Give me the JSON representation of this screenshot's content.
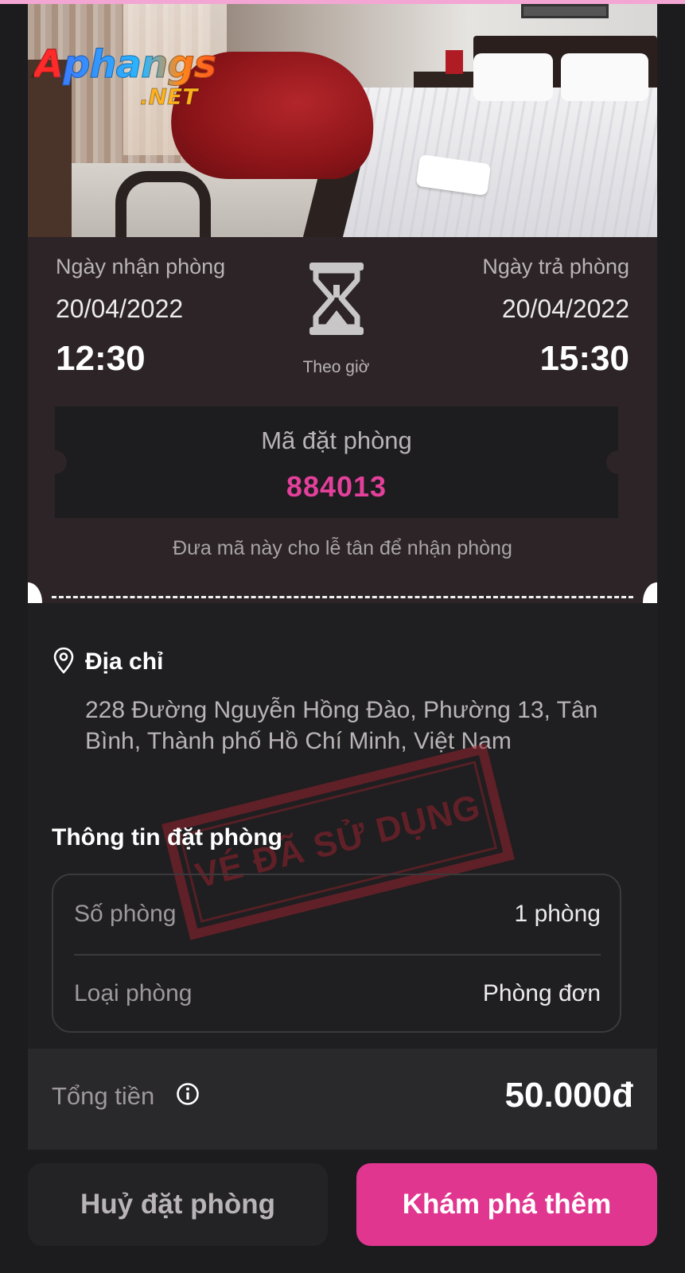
{
  "branding": {
    "logo_text": "Aphangs",
    "logo_tld": ".NET"
  },
  "booking": {
    "checkin_label": "Ngày nhận phòng",
    "checkin_date": "20/04/2022",
    "checkin_time": "12:30",
    "checkout_label": "Ngày trả phòng",
    "checkout_date": "20/04/2022",
    "checkout_time": "15:30",
    "mode_label": "Theo giờ",
    "code_label": "Mã đặt phòng",
    "code_value": "884013",
    "code_hint": "Đưa mã này cho lễ tân để nhận phòng"
  },
  "address": {
    "title": "Địa chỉ",
    "text": "228 Đường Nguyễn Hồng Đào, Phường 13, Tân Bình, Thành phố Hồ Chí Minh, Việt Nam"
  },
  "info": {
    "title": "Thông tin đặt phòng",
    "rows": [
      {
        "label": "Số phòng",
        "value": "1 phòng"
      },
      {
        "label": "Loại phòng",
        "value": "Phòng đơn"
      }
    ]
  },
  "stamp": {
    "text": "VÉ ĐÃ SỬ DỤNG"
  },
  "total": {
    "label": "Tổng tiền",
    "value": "50.000đ"
  },
  "actions": {
    "cancel_label": "Huỷ đặt phòng",
    "explore_label": "Khám phá thêm"
  },
  "colors": {
    "accent": "#e0368f",
    "code": "#e2409a",
    "top_accent": "#f3a6d3"
  },
  "icons": {
    "hourglass": "hourglass-icon",
    "location": "location-pin-icon",
    "info": "info-icon"
  }
}
